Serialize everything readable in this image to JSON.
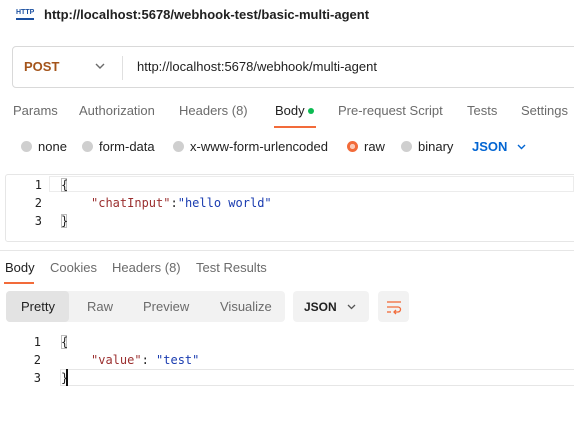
{
  "title": {
    "icon_text": "HTTP",
    "text": "http://localhost:5678/webhook-test/basic-multi-agent"
  },
  "request": {
    "method": "POST",
    "url": "http://localhost:5678/webhook/multi-agent",
    "tabs": [
      {
        "label": "Params"
      },
      {
        "label": "Authorization"
      },
      {
        "label": "Headers (8)"
      },
      {
        "label": "Body"
      },
      {
        "label": "Pre-request Script"
      },
      {
        "label": "Tests"
      },
      {
        "label": "Settings"
      }
    ],
    "active_tab": "Body",
    "body_types": [
      {
        "label": "none"
      },
      {
        "label": "form-data"
      },
      {
        "label": "x-www-form-urlencoded"
      },
      {
        "label": "raw"
      },
      {
        "label": "binary"
      }
    ],
    "selected_body_type": "raw",
    "language": "JSON",
    "editor_lines": [
      {
        "num": "1",
        "open": "{"
      },
      {
        "num": "2",
        "key": "\"chatInput\"",
        "colon": ":",
        "value": "\"hello world\""
      },
      {
        "num": "3",
        "close": "}"
      }
    ]
  },
  "response": {
    "tabs": [
      {
        "label": "Body"
      },
      {
        "label": "Cookies"
      },
      {
        "label": "Headers (8)"
      },
      {
        "label": "Test Results"
      }
    ],
    "active_tab": "Body",
    "formats": [
      {
        "label": "Pretty"
      },
      {
        "label": "Raw"
      },
      {
        "label": "Preview"
      },
      {
        "label": "Visualize"
      }
    ],
    "active_format": "Pretty",
    "language": "JSON",
    "wrap_icon": "wrap-lines-icon",
    "lines": [
      {
        "num": "1",
        "open": "{"
      },
      {
        "num": "2",
        "key": "\"value\"",
        "colon": ": ",
        "value": "\"test\""
      },
      {
        "num": "3",
        "close": "}"
      }
    ]
  },
  "colors": {
    "method": "#a4541a",
    "accent": "#f26b3a",
    "link": "#0265d2",
    "status_dot": "#0cbb52"
  }
}
